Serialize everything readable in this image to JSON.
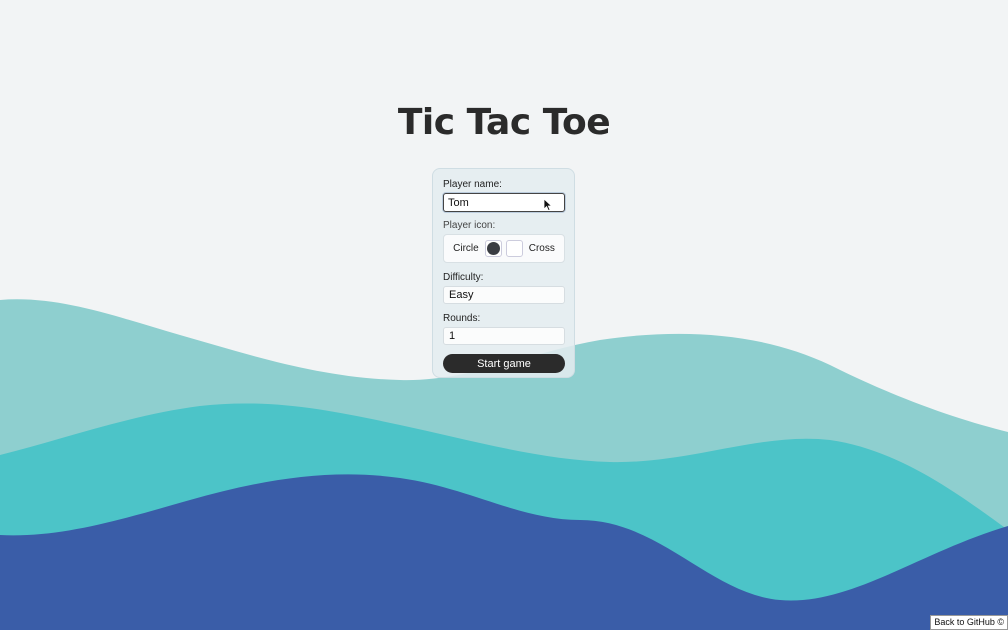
{
  "page": {
    "title": "Tic Tac Toe"
  },
  "form": {
    "player_name_label": "Player name:",
    "player_name_value": "Tom",
    "player_icon_label": "Player icon:",
    "icon_circle_label": "Circle",
    "icon_cross_label": "Cross",
    "selected_icon": "circle",
    "difficulty_label": "Difficulty:",
    "difficulty_value": "Easy",
    "rounds_label": "Rounds:",
    "rounds_value": "1",
    "start_button_label": "Start game"
  },
  "footer": {
    "github_link": "Back to GitHub ©"
  },
  "colors": {
    "background": "#f2f4f5",
    "wave_light": "#8ecfcf",
    "wave_mid": "#4cc4c8",
    "wave_dark": "#3a5da8",
    "button": "#2b2b2b"
  },
  "icons": {
    "circle_icon": "filled-dark-circle",
    "cursor_icon": "arrow-pointer"
  }
}
